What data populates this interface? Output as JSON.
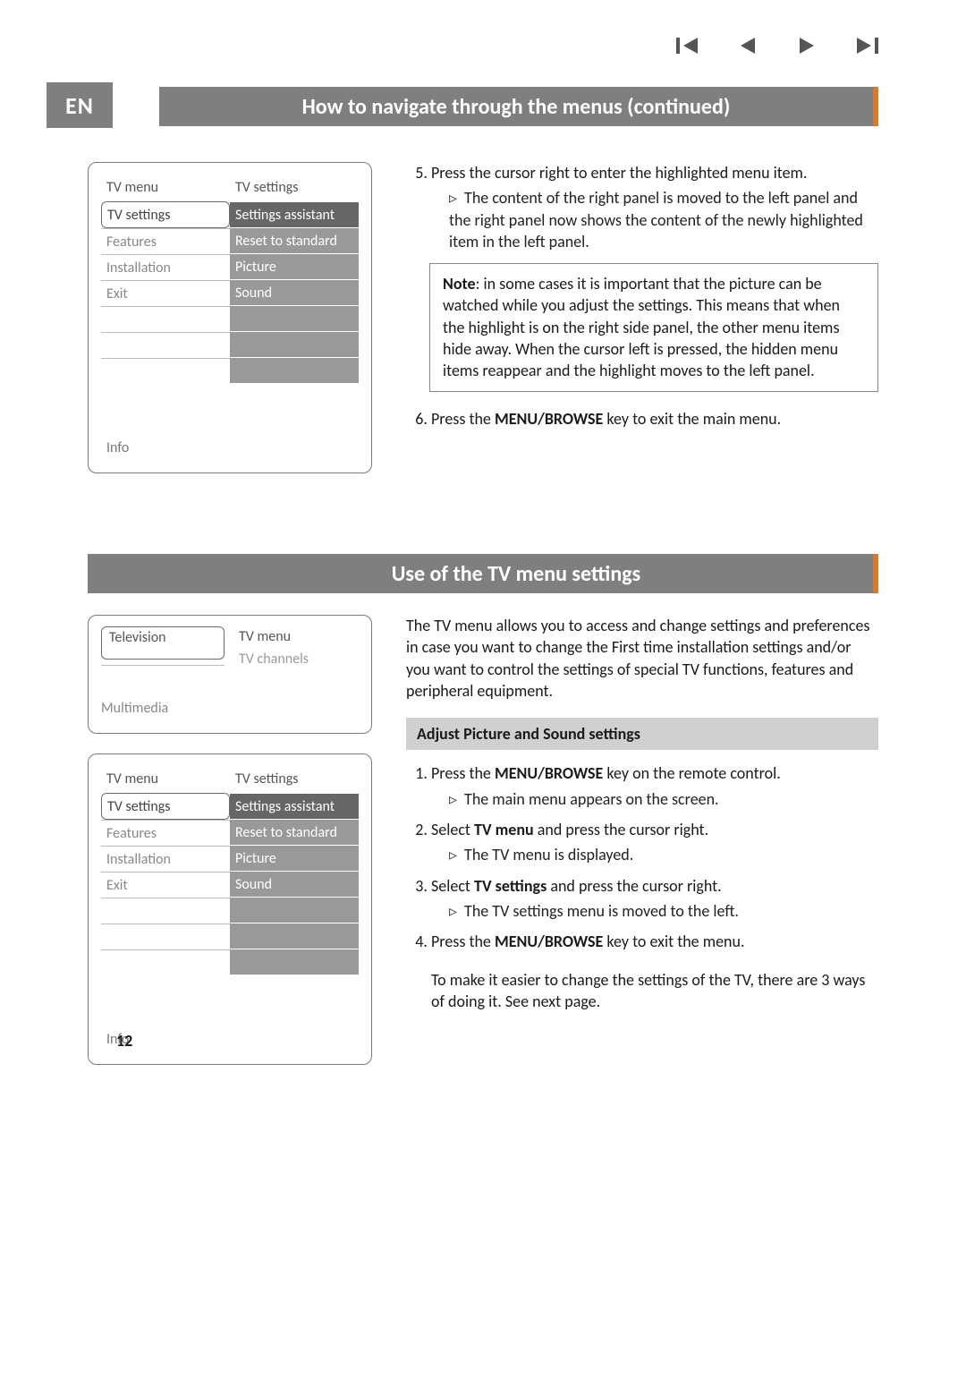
{
  "lang_badge": "EN",
  "transport": {
    "first": "skip-first",
    "prev": "prev",
    "next": "next",
    "last": "skip-last"
  },
  "section1": {
    "title": "How to navigate through the menus  (continued)",
    "menu": {
      "left_header": "TV menu",
      "right_header": "TV settings",
      "left_items": [
        "TV settings",
        "Features",
        "Installation",
        "Exit"
      ],
      "right_items": [
        "Settings assistant",
        "Reset to standard",
        "Picture",
        "Sound"
      ],
      "info": "Info"
    },
    "step5_num": "5.",
    "step5_text": "Press the cursor right to enter the highlighted menu item.",
    "step5_sub": "The content of the right panel is moved to the left panel and the right panel now shows the content of the newly highlighted item in the left panel.",
    "note_label": "Note",
    "note_text": ": in some cases it is important that the picture can be watched while you adjust the settings. This means that when the highlight is on the right side panel, the other menu items hide away. When the cursor left is pressed, the hidden menu items reappear and the highlight moves to the left panel.",
    "step6_num": "6.",
    "step6_pre": "Press the ",
    "step6_bold": "MENU/BROWSE",
    "step6_post": " key to exit the main menu."
  },
  "section2": {
    "title": "Use of the TV menu settings",
    "topnav": {
      "television": "Television",
      "tv_menu": "TV menu",
      "tv_channels": "TV channels",
      "multimedia": "Multimedia"
    },
    "menu": {
      "left_header": "TV menu",
      "right_header": "TV settings",
      "left_items": [
        "TV settings",
        "Features",
        "Installation",
        "Exit"
      ],
      "right_items": [
        "Settings assistant",
        "Reset to standard",
        "Picture",
        "Sound"
      ],
      "info": "Info"
    },
    "intro": "The TV menu allows you to access and change settings and preferences in case you want to change the First time installation settings and/or you want to control the settings of special TV functions, features and peripheral equipment.",
    "subhead": "Adjust Picture and Sound settings",
    "steps": {
      "s1_pre": "Press the ",
      "s1_bold": "MENU/BROWSE",
      "s1_post": " key on the remote control.",
      "s1_sub": "The main menu appears on the screen.",
      "s2_pre": "Select ",
      "s2_bold": "TV menu",
      "s2_post": " and press the cursor right.",
      "s2_sub": "The TV menu is displayed.",
      "s3_pre": "Select ",
      "s3_bold": "TV settings",
      "s3_post": " and press the cursor right.",
      "s3_sub": "The TV settings menu is moved to the left.",
      "s4_pre": "Press the ",
      "s4_bold": "MENU/BROWSE",
      "s4_post": " key to exit the menu.",
      "footer": "To make it easier to change the settings of the TV, there are 3 ways of doing it. See next page."
    }
  },
  "page_number": "12"
}
